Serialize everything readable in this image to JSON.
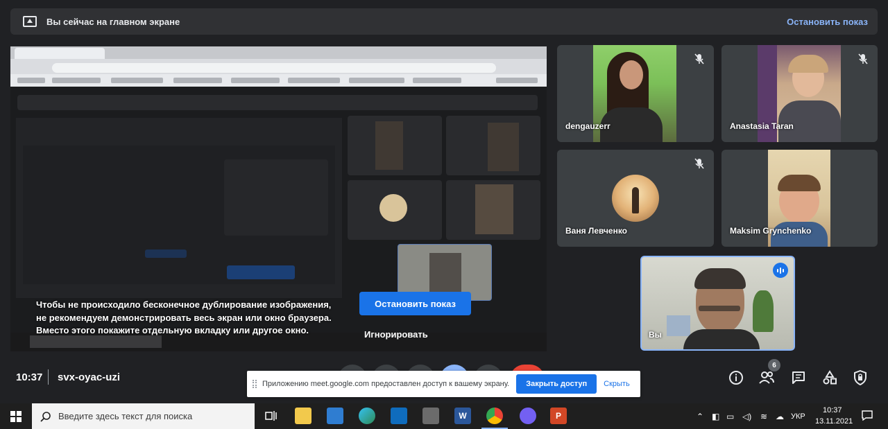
{
  "present_bar": {
    "text": "Вы сейчас на главном экране",
    "stop_link": "Остановить показ"
  },
  "share": {
    "message_lines": [
      "Чтобы не происходило бесконечное дублирование изображения,",
      "не рекомендуем демонстрировать весь экран или окно браузера.",
      "Вместо этого покажите отдельную вкладку или другое окно."
    ],
    "stop_button": "Остановить показ",
    "ignore_button": "Игнорировать"
  },
  "participants": [
    {
      "name": "dengauzerr",
      "muted": true
    },
    {
      "name": "Anastasia Taran",
      "muted": true
    },
    {
      "name": "Ваня Левченко",
      "muted": true
    },
    {
      "name": "Maksim Grynchenko",
      "muted": false
    }
  ],
  "self": {
    "name": "Вы",
    "speaking": true
  },
  "meeting": {
    "time": "10:37",
    "code": "svx-oyac-uzi",
    "people_count": "6"
  },
  "notice": {
    "text": "Приложению meet.google.com предоставлен доступ к вашему экрану.",
    "close_button": "Закрыть доступ",
    "hide_link": "Скрыть"
  },
  "taskbar": {
    "search_placeholder": "Введите здесь текст для поиска",
    "word_icon": "W",
    "powerpoint_icon": "P",
    "language": "УКР",
    "time": "10:37",
    "date": "13.11.2021"
  },
  "colors": {
    "background": "#202124",
    "accent": "#1a73e8",
    "link": "#8ab4f8",
    "end_call": "#ea4335"
  }
}
